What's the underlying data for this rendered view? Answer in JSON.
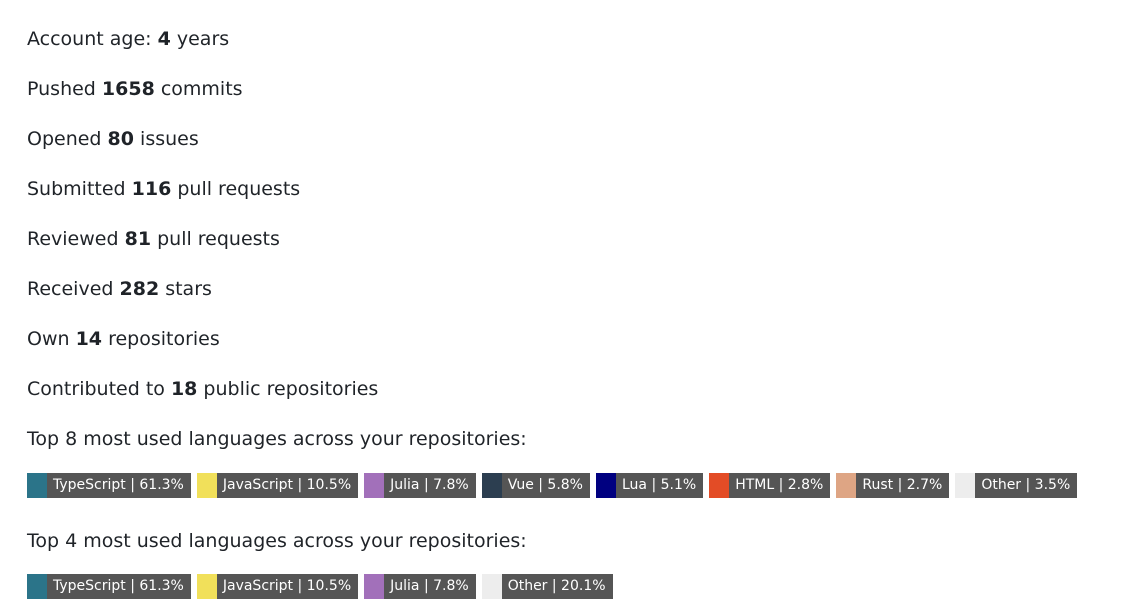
{
  "stats": [
    {
      "prefix": "Account age: ",
      "value": "4",
      "suffix": " years"
    },
    {
      "prefix": "Pushed ",
      "value": "1658",
      "suffix": " commits"
    },
    {
      "prefix": "Opened ",
      "value": "80",
      "suffix": " issues"
    },
    {
      "prefix": "Submitted ",
      "value": "116",
      "suffix": " pull requests"
    },
    {
      "prefix": "Reviewed ",
      "value": "81",
      "suffix": " pull requests"
    },
    {
      "prefix": "Received ",
      "value": "282",
      "suffix": " stars"
    },
    {
      "prefix": "Own ",
      "value": "14",
      "suffix": " repositories"
    },
    {
      "prefix": "Contributed to ",
      "value": "18",
      "suffix": " public repositories"
    }
  ],
  "top8": {
    "heading": "Top 8 most used languages across your repositories:",
    "badges": [
      {
        "label": "TypeScript | 61.3%",
        "color": "#2b7489"
      },
      {
        "label": "JavaScript | 10.5%",
        "color": "#f1e05a"
      },
      {
        "label": "Julia | 7.8%",
        "color": "#a270ba"
      },
      {
        "label": "Vue | 5.8%",
        "color": "#2c3e50"
      },
      {
        "label": "Lua | 5.1%",
        "color": "#000080"
      },
      {
        "label": "HTML | 2.8%",
        "color": "#e34c26"
      },
      {
        "label": "Rust | 2.7%",
        "color": "#dea584"
      },
      {
        "label": "Other | 3.5%",
        "color": "#ededed"
      }
    ]
  },
  "top4": {
    "heading": "Top 4 most used languages across your repositories:",
    "badges": [
      {
        "label": "TypeScript | 61.3%",
        "color": "#2b7489"
      },
      {
        "label": "JavaScript | 10.5%",
        "color": "#f1e05a"
      },
      {
        "label": "Julia | 7.8%",
        "color": "#a270ba"
      },
      {
        "label": "Other | 20.1%",
        "color": "#ededed"
      }
    ]
  }
}
